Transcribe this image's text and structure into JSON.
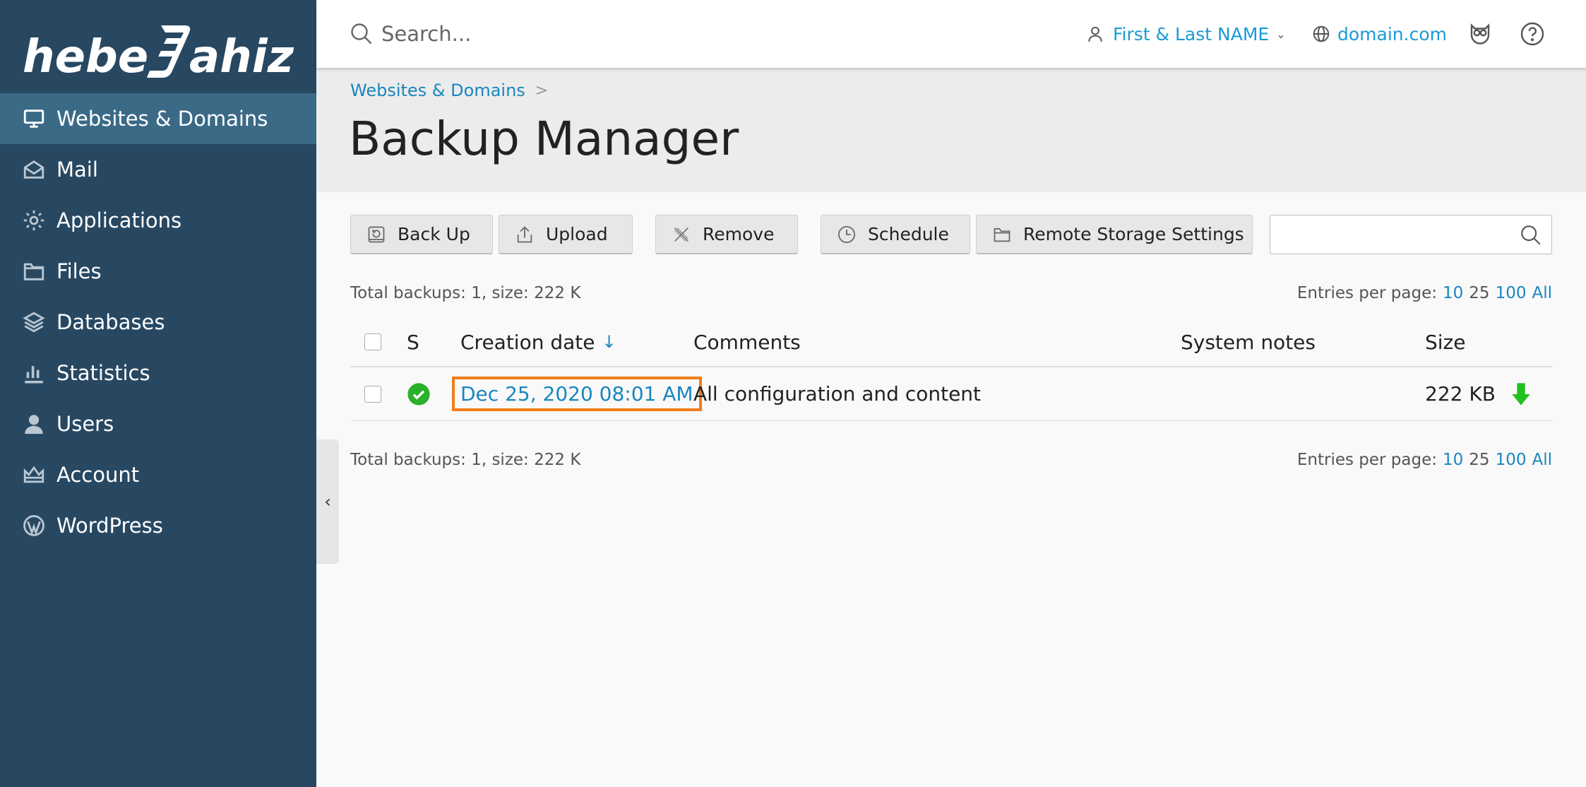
{
  "brand": {
    "logo_text": "hebe Jahiz"
  },
  "sidebar": {
    "items": [
      {
        "label": "Websites & Domains",
        "icon": "monitor-icon",
        "active": true
      },
      {
        "label": "Mail",
        "icon": "envelope-icon"
      },
      {
        "label": "Applications",
        "icon": "gear-icon"
      },
      {
        "label": "Files",
        "icon": "folder-icon"
      },
      {
        "label": "Databases",
        "icon": "layers-icon"
      },
      {
        "label": "Statistics",
        "icon": "bar-chart-icon"
      },
      {
        "label": "Users",
        "icon": "user-icon"
      },
      {
        "label": "Account",
        "icon": "crown-icon"
      },
      {
        "label": "WordPress",
        "icon": "wordpress-icon"
      }
    ]
  },
  "header": {
    "search_placeholder": "Search...",
    "user_name": "First & Last NAME",
    "domain": "domain.com"
  },
  "breadcrumb": {
    "items": [
      "Websites & Domains"
    ]
  },
  "page": {
    "title": "Backup Manager"
  },
  "toolbar": {
    "backup_label": "Back Up",
    "upload_label": "Upload",
    "remove_label": "Remove",
    "schedule_label": "Schedule",
    "remote_storage_label": "Remote Storage Settings"
  },
  "summary": {
    "top": "Total backups: 1, size: 222 K",
    "bottom": "Total backups: 1, size: 222 K",
    "entries_label": "Entries per page:",
    "options": [
      "10",
      "25",
      "100",
      "All"
    ],
    "current": "25"
  },
  "table": {
    "columns": {
      "status": "S",
      "date": "Creation date",
      "comments": "Comments",
      "notes": "System notes",
      "size": "Size"
    },
    "sort_indicator": "↓",
    "rows": [
      {
        "date": "Dec 25, 2020 08:01 AM",
        "comments": "All configuration and content",
        "notes": "",
        "size": "222 KB",
        "status": "ok"
      }
    ]
  },
  "colors": {
    "sidebar_bg": "#284862",
    "sidebar_active": "#3b6a87",
    "link": "#1a86c0",
    "highlight_border": "#f07d1a",
    "ok_green": "#2bb02b",
    "download_green": "#22c01e"
  }
}
